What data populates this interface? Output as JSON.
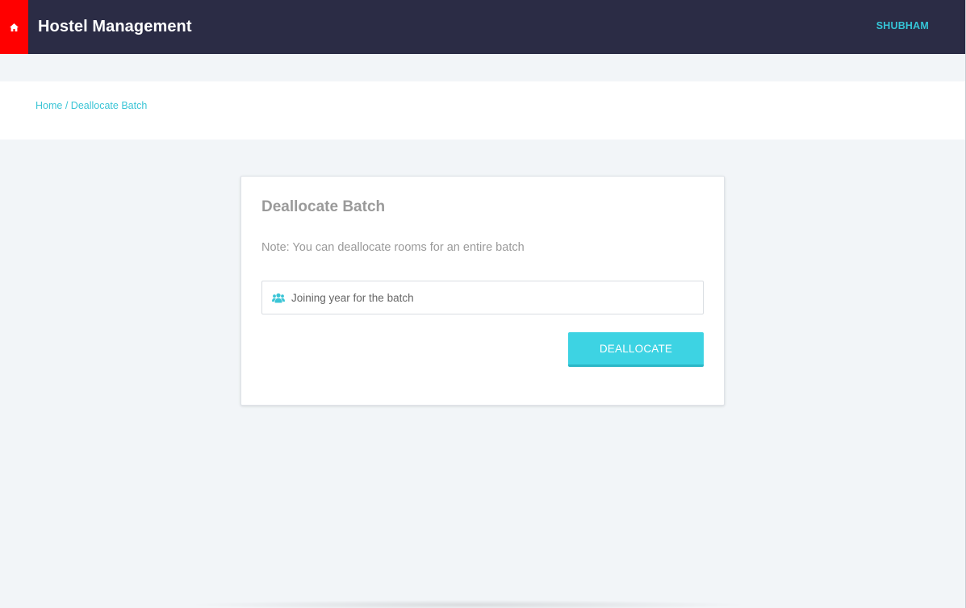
{
  "navbar": {
    "home_icon": "home-icon",
    "brand": "Hostel Management",
    "user": "SHUBHAM"
  },
  "breadcrumb": {
    "home": "Home",
    "separator": "/",
    "current": "Deallocate Batch"
  },
  "card": {
    "title": "Deallocate Batch",
    "note": "Note: You can deallocate rooms for an entire batch",
    "input": {
      "icon": "users-icon",
      "placeholder": "Joining year for the batch",
      "value": ""
    },
    "button_label": "DEALLOCATE"
  },
  "colors": {
    "navbar_bg": "#2b2c45",
    "home_box": "#ff0000",
    "accent": "#3dd3e3",
    "link": "#3bc5d6"
  }
}
